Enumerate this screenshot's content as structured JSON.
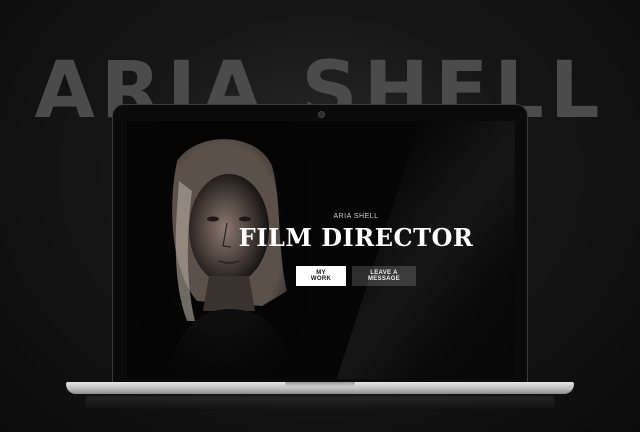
{
  "background": {
    "title": "ARIA SHELL"
  },
  "site": {
    "name": "ARIA SHELL",
    "headline": "FILM DIRECTOR",
    "buttons": {
      "primary": "MY WORK",
      "secondary": "LEAVE A MESSAGE"
    }
  },
  "colors": {
    "accent": "#ffffff",
    "background": "#0b0b0b",
    "secondary_button": "#2e2e2e"
  }
}
